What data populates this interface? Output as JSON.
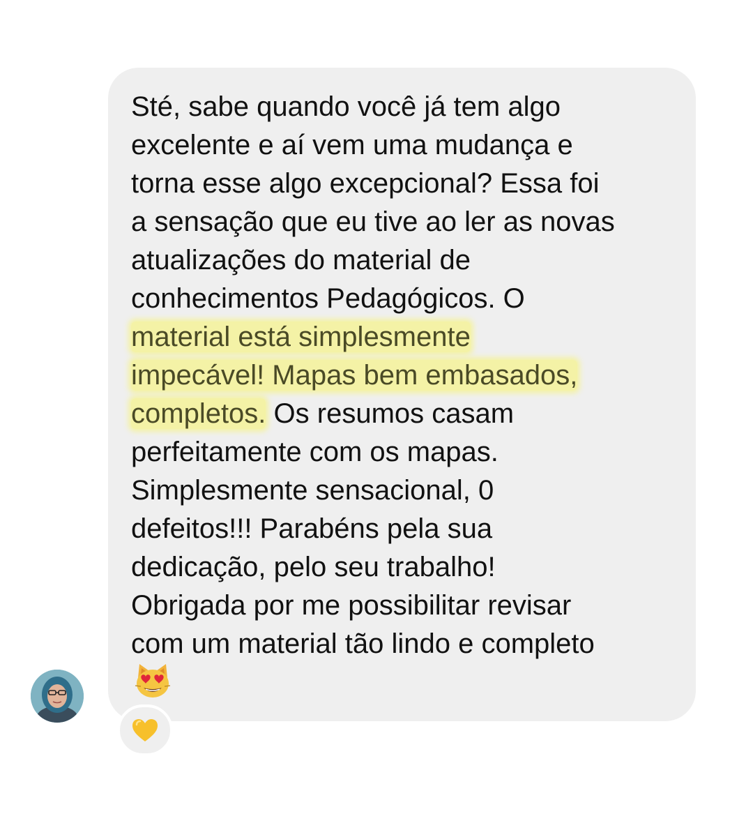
{
  "message": {
    "lines": [
      {
        "pre": "Sté, sabe quando você já tem algo",
        "hl": "",
        "post": ""
      },
      {
        "pre": "excelente e aí vem uma mudança e",
        "hl": "",
        "post": ""
      },
      {
        "pre": "torna esse algo excepcional? Essa foi",
        "hl": "",
        "post": ""
      },
      {
        "pre": "a sensação que eu tive ao ler as novas",
        "hl": "",
        "post": ""
      },
      {
        "pre": "atualizações do material de",
        "hl": "",
        "post": ""
      },
      {
        "pre": "conhecimentos Pedagógicos. O",
        "hl": "",
        "post": ""
      },
      {
        "pre": "",
        "hl": "material está simplesmente",
        "post": ""
      },
      {
        "pre": "",
        "hl": "impecável! Mapas bem embasados,",
        "post": ""
      },
      {
        "pre": "",
        "hl": "completos.",
        "post": " Os resumos casam"
      },
      {
        "pre": "perfeitamente com os mapas.",
        "hl": "",
        "post": ""
      },
      {
        "pre": "Simplesmente sensacional, 0",
        "hl": "",
        "post": ""
      },
      {
        "pre": "defeitos!!! Parabéns pela sua",
        "hl": "",
        "post": ""
      },
      {
        "pre": "dedicação, pelo seu trabalho!",
        "hl": "",
        "post": ""
      },
      {
        "pre": "Obrigada por me possibilitar revisar",
        "hl": "",
        "post": ""
      },
      {
        "pre": "com um material tão lindo e completo",
        "hl": "",
        "post": ""
      }
    ],
    "trailing_emoji": "heart-eyes-cat-emoji"
  },
  "reaction": {
    "emoji": "yellow-heart-emoji"
  },
  "avatar": {
    "icon": "profile-photo"
  },
  "colors": {
    "bubble_bg": "#efefef",
    "highlight": "#f4f2a6",
    "text": "#111111"
  }
}
